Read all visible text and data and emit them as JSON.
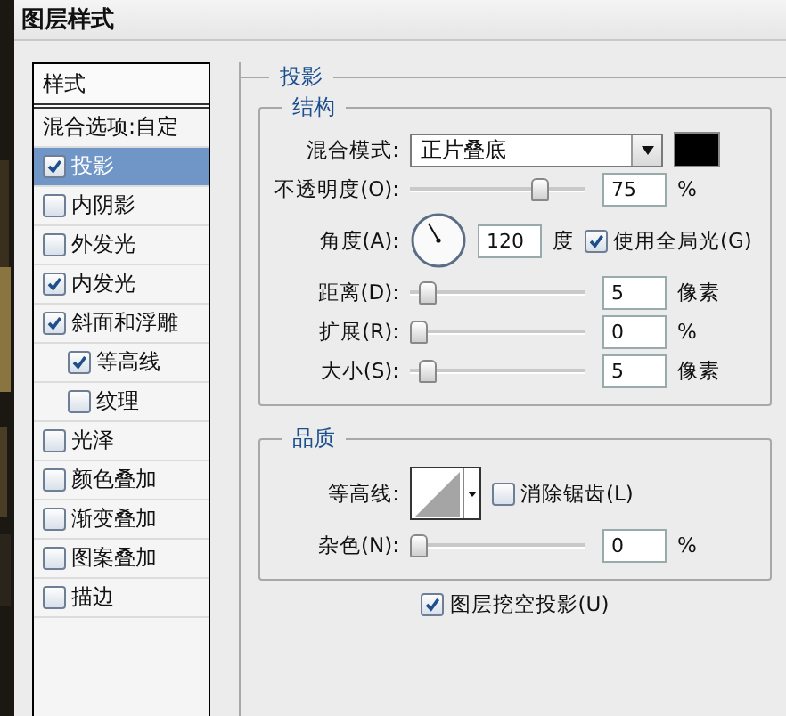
{
  "window": {
    "title": "图层样式"
  },
  "styles_list": {
    "header": "样式",
    "items": [
      {
        "kind": "plain",
        "label": "混合选项:自定",
        "selected": false
      },
      {
        "kind": "check",
        "label": "投影",
        "checked": true,
        "selected": true
      },
      {
        "kind": "check",
        "label": "内阴影",
        "checked": false,
        "selected": false
      },
      {
        "kind": "check",
        "label": "外发光",
        "checked": false,
        "selected": false
      },
      {
        "kind": "check",
        "label": "内发光",
        "checked": true,
        "selected": false
      },
      {
        "kind": "check",
        "label": "斜面和浮雕",
        "checked": true,
        "selected": false,
        "children": [
          {
            "kind": "check",
            "label": "等高线",
            "checked": true,
            "selected": false
          },
          {
            "kind": "check",
            "label": "纹理",
            "checked": false,
            "selected": false
          }
        ]
      },
      {
        "kind": "check",
        "label": "光泽",
        "checked": false,
        "selected": false
      },
      {
        "kind": "check",
        "label": "颜色叠加",
        "checked": false,
        "selected": false
      },
      {
        "kind": "check",
        "label": "渐变叠加",
        "checked": false,
        "selected": false
      },
      {
        "kind": "check",
        "label": "图案叠加",
        "checked": false,
        "selected": false
      },
      {
        "kind": "check",
        "label": "描边",
        "checked": false,
        "selected": false
      }
    ]
  },
  "panel": {
    "title": "投影",
    "structure": {
      "title": "结构",
      "blend_mode": {
        "label": "混合模式:",
        "value": "正片叠底",
        "color": "#000000"
      },
      "opacity": {
        "label": "不透明度(O):",
        "level": 0.75,
        "value": "75",
        "unit": "%"
      },
      "angle": {
        "label": "角度(A):",
        "value": "120",
        "unit": "度",
        "global_light": {
          "label": "使用全局光(G)",
          "checked": true
        }
      },
      "sliders": [
        {
          "label": "距离(D):",
          "level": 0.05,
          "value": "5",
          "unit": "像素"
        },
        {
          "label": "扩展(R):",
          "level": 0,
          "value": "0",
          "unit": "%"
        },
        {
          "label": "大小(S):",
          "level": 0.05,
          "value": "5",
          "unit": "像素"
        }
      ]
    },
    "quality": {
      "title": "品质",
      "contour": {
        "label": "等高线:",
        "anti_alias": {
          "label": "消除锯齿(L)",
          "checked": false
        }
      },
      "noise": {
        "label": "杂色(N):",
        "level": 0,
        "value": "0",
        "unit": "%"
      }
    },
    "knockout": {
      "label": "图层挖空投影(U)",
      "checked": true
    }
  }
}
